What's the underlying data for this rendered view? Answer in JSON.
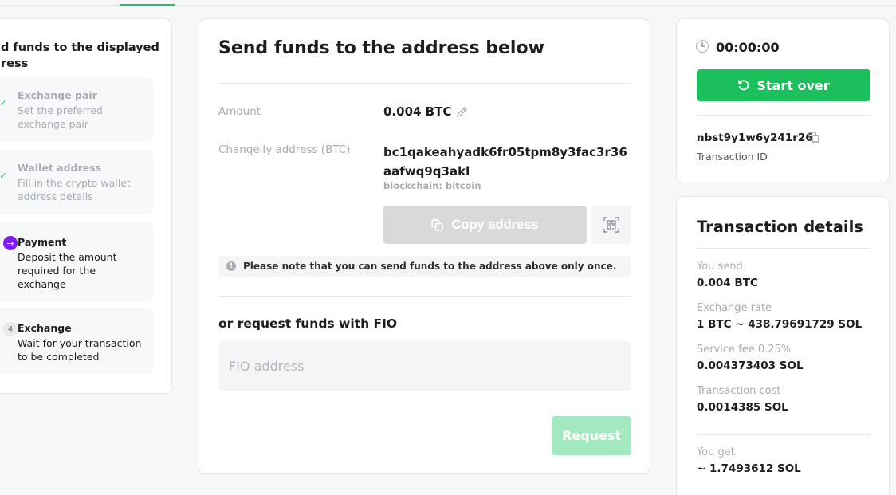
{
  "steps": {
    "title": "d funds to the displayed ress",
    "title_line1": "d funds to the displayed",
    "title_line2": "ress",
    "items": [
      {
        "title": "Exchange pair",
        "desc": "Set the preferred exchange pair",
        "status": "done",
        "marker": "✓"
      },
      {
        "title": "Wallet address",
        "desc": "Fill in the crypto wallet address details",
        "status": "done",
        "marker": "✓"
      },
      {
        "title": "Payment",
        "desc": "Deposit the amount required for the exchange",
        "status": "active",
        "marker": "→"
      },
      {
        "title": "Exchange",
        "desc": "Wait for your transaction to be completed",
        "status": "todo",
        "marker": "4"
      }
    ]
  },
  "main": {
    "title": "Send funds to the address below",
    "amount_label": "Amount",
    "amount_value": "0.004 BTC",
    "address_label": "Changelly address (BTC)",
    "address_value": "bc1qakeahyadk6fr05tpm8y3fac3r36aafwq9q3akl",
    "blockchain": "blockchain: bitcoin",
    "copy_button": "Copy address",
    "note": "Please note that you can send funds to the address above only once.",
    "fio_title": "or request funds with FIO",
    "fio_placeholder": "FIO address",
    "request_button": "Request"
  },
  "timer": {
    "time": "00:00:00",
    "start_over": "Start over",
    "transaction_id": "nbst9y1w6y241r26",
    "transaction_id_label": "Transaction ID"
  },
  "details": {
    "title": "Transaction details",
    "rows": [
      {
        "label": "You send",
        "value": "0.004 BTC"
      },
      {
        "label": "Exchange rate",
        "value": "1 BTC ~ 438.79691729 SOL"
      },
      {
        "label": "Service fee 0.25%",
        "value": "0.004373403 SOL"
      },
      {
        "label": "Transaction cost",
        "value": "0.0014385 SOL"
      }
    ],
    "you_get_label": "You get",
    "you_get_value": "~ 1.7493612 SOL"
  },
  "colors": {
    "accent_green": "#1bbf5c",
    "active_purple": "#7b1cf2",
    "disabled_gray": "#d9d9da",
    "request_disabled": "#a4e8c2"
  }
}
